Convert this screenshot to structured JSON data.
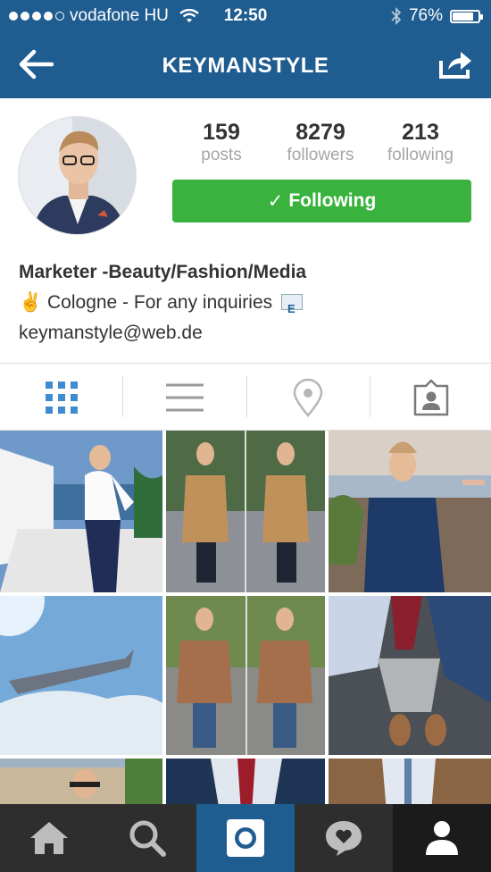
{
  "status_bar": {
    "carrier": "vodafone HU",
    "time": "12:50",
    "battery": "76%",
    "battery_level": 0.76
  },
  "nav": {
    "title": "KEYMANSTYLE",
    "back_icon": "back-arrow-icon",
    "share_icon": "share-icon"
  },
  "profile": {
    "stats": [
      {
        "value": "159",
        "label": "posts"
      },
      {
        "value": "8279",
        "label": "followers"
      },
      {
        "value": "213",
        "label": "following"
      }
    ],
    "follow_button": {
      "check": "✓",
      "label": "Following"
    },
    "bio": {
      "name": "Marketer -Beauty/Fashion/Media",
      "line2_emoji": "✌️",
      "line2_text": "Cologne - For any inquiries",
      "line2_icon": "E",
      "email": "keymanstyle@web.de"
    }
  },
  "view_tabs": [
    {
      "name": "grid-view",
      "icon": "grid-icon",
      "active": true
    },
    {
      "name": "list-view",
      "icon": "list-icon",
      "active": false
    },
    {
      "name": "map-view",
      "icon": "location-pin-icon",
      "active": false
    },
    {
      "name": "tagged-view",
      "icon": "tagged-user-icon",
      "active": false
    }
  ],
  "bottom_nav": [
    {
      "name": "home",
      "icon": "home-icon"
    },
    {
      "name": "explore",
      "icon": "search-icon"
    },
    {
      "name": "camera",
      "icon": "camera-icon"
    },
    {
      "name": "activity",
      "icon": "heart-bubble-icon"
    },
    {
      "name": "profile",
      "icon": "profile-icon",
      "active": true
    }
  ],
  "colors": {
    "header": "#1f5d91",
    "follow_green": "#3ab33e",
    "active_tab_blue": "#3f8bd0",
    "bottom_bar": "#2e2e2e"
  }
}
